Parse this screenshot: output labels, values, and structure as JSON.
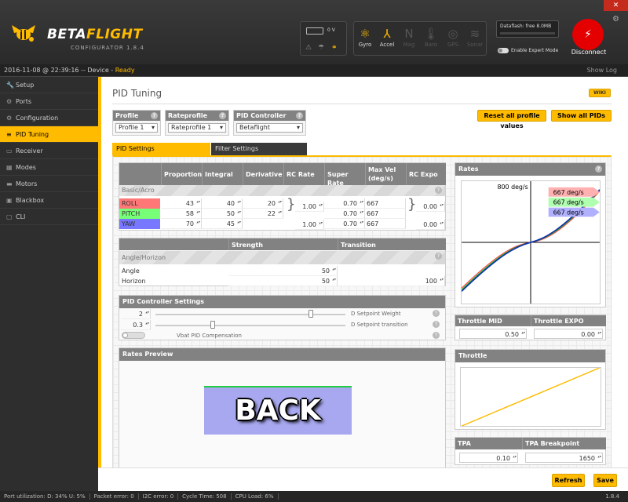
{
  "app": {
    "brand_prefix": "BETA",
    "brand_suffix": "FLIGHT",
    "brand_sub": "CONFIGURATOR 1.8.4",
    "battery_label": "0 V",
    "window_close": "✕",
    "settings_icon": "gear-icon",
    "sensors": [
      {
        "label": "Gyro",
        "icon": "gyro-icon",
        "glyph": "⚛",
        "active": true
      },
      {
        "label": "Accel",
        "icon": "accel-icon",
        "glyph": "⅄",
        "active": true
      },
      {
        "label": "Mag",
        "icon": "mag-icon",
        "glyph": "N",
        "active": false
      },
      {
        "label": "Baro",
        "icon": "baro-icon",
        "glyph": "🌡",
        "active": false
      },
      {
        "label": "GPS",
        "icon": "gps-icon",
        "glyph": "◎",
        "active": false
      },
      {
        "label": "Sonar",
        "icon": "sonar-icon",
        "glyph": "≋",
        "active": false
      }
    ],
    "dataflash": "Dataflash: free 8.0MB",
    "expert_mode": "Enable Expert Mode",
    "disconnect": "Disconnect",
    "accent": "#ffbb00"
  },
  "statusline": {
    "datetime": "2016-11-08 @ 22:39:16",
    "sep": " -- Device - ",
    "state": "Ready",
    "show_log": "Show Log"
  },
  "sidebar": {
    "items": [
      {
        "label": "Setup",
        "icon": "wrench-icon",
        "glyph": "🔧"
      },
      {
        "label": "Ports",
        "icon": "ports-icon",
        "glyph": "⚙"
      },
      {
        "label": "Configuration",
        "icon": "config-icon",
        "glyph": "⚙"
      },
      {
        "label": "PID Tuning",
        "icon": "sliders-icon",
        "glyph": "≡"
      },
      {
        "label": "Receiver",
        "icon": "receiver-icon",
        "glyph": "▭"
      },
      {
        "label": "Modes",
        "icon": "modes-icon",
        "glyph": "▦"
      },
      {
        "label": "Motors",
        "icon": "motors-icon",
        "glyph": "▬"
      },
      {
        "label": "Blackbox",
        "icon": "blackbox-icon",
        "glyph": "▣"
      },
      {
        "label": "CLI",
        "icon": "cli-icon",
        "glyph": "▢"
      }
    ]
  },
  "pid": {
    "title": "PID Tuning",
    "wiki": "WIKI",
    "profile": {
      "label": "Profile",
      "value": "Profile 1"
    },
    "rateprofile": {
      "label": "Rateprofile",
      "value": "Rateprofile 1"
    },
    "controller": {
      "label": "PID Controller",
      "value": "Betaflight"
    },
    "reset_btn": "Reset all profile values",
    "show_btn": "Show all PIDs",
    "tabs": {
      "pid": "PID Settings",
      "filter": "Filter Settings"
    },
    "table": {
      "headers": [
        "Proportional",
        "Integral",
        "Derivative",
        "RC Rate",
        "Super Rate",
        "Max Vel (deg/s)",
        "RC Expo"
      ],
      "section": "Basic/Acro",
      "rows": [
        {
          "axis": "ROLL",
          "color": "#ff7777",
          "p": "43",
          "i": "40",
          "d": "20",
          "super": "0.70",
          "maxvel": "667"
        },
        {
          "axis": "PITCH",
          "color": "#77ff77",
          "p": "58",
          "i": "50",
          "d": "22",
          "super": "0.70",
          "maxvel": "667"
        },
        {
          "axis": "YAW",
          "color": "#7777ff",
          "p": "70",
          "i": "45",
          "d": "",
          "super": "0.70",
          "maxvel": "667"
        }
      ],
      "rc_rate_rp": "1.00",
      "rc_rate_yaw": "1.00",
      "rc_expo_rp": "0.00",
      "rc_expo_yaw": "0.00"
    },
    "angle": {
      "headers": [
        "Strength",
        "Transition"
      ],
      "section": "Angle/Horizon",
      "rows": [
        {
          "label": "Angle",
          "strength": "50",
          "transition": ""
        },
        {
          "label": "Horizon",
          "strength": "50",
          "transition": "100"
        }
      ]
    },
    "controller_settings": {
      "title": "PID Controller Settings",
      "setpoint_weight": "2",
      "setpoint_transition": "0.3",
      "setpoint_weight_label": "D Setpoint Weight",
      "setpoint_transition_label": "D Setpoint transition",
      "vbat_label": "Vbat PID Compensation",
      "setpoint_weight_pos": 0.82,
      "setpoint_transition_pos": 0.3
    },
    "rates_preview": {
      "title": "Rates Preview",
      "back_label": "BACK"
    },
    "rates_chart": {
      "title": "Rates",
      "max_label": "800 deg/s",
      "legend": [
        {
          "label": "667 deg/s",
          "color": "#ffb0b0"
        },
        {
          "label": "667 deg/s",
          "color": "#b0ffb0"
        },
        {
          "label": "667 deg/s",
          "color": "#b0b0ff"
        }
      ]
    },
    "throttle_mid": {
      "label": "Throttle MID",
      "value": "0.50"
    },
    "throttle_expo": {
      "label": "Throttle EXPO",
      "value": "0.00"
    },
    "throttle_chart": {
      "title": "Throttle"
    },
    "tpa": {
      "label": "TPA",
      "value": "0.10"
    },
    "tpa_breakpoint": {
      "label": "TPA Breakpoint",
      "value": "1650"
    },
    "refresh": "Refresh",
    "save": "Save"
  },
  "footer": {
    "port_util": "Port utilization: D: 34% U: 5%",
    "packet_error": "Packet error: 0",
    "i2c_error": "I2C error: 0",
    "cycle_time": "Cycle Time: 508",
    "cpu_load": "CPU Load: 6%",
    "version": "1.8.4"
  }
}
